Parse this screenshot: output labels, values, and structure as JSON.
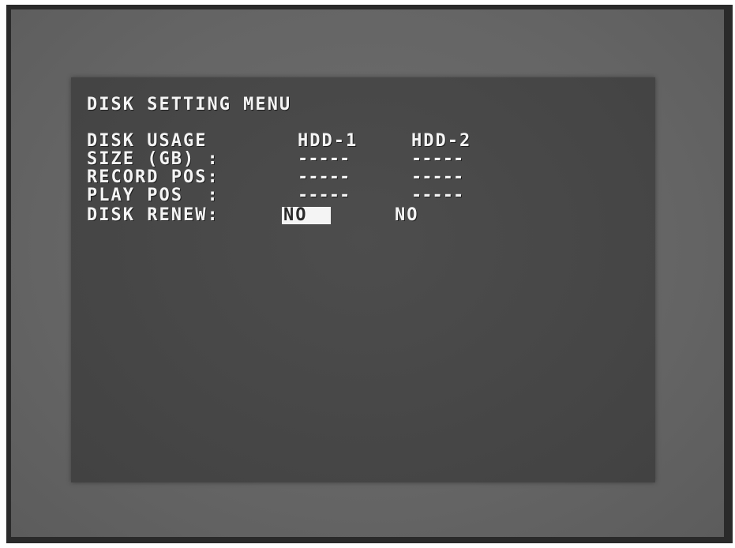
{
  "menu": {
    "title": "DISK SETTING MENU",
    "rows": [
      {
        "label": "DISK USAGE",
        "hdd1": "HDD-1",
        "hdd2": "HDD-2"
      },
      {
        "label": "SIZE (GB) :",
        "hdd1": "-----",
        "hdd2": "-----"
      },
      {
        "label": "RECORD POS:",
        "hdd1": "-----",
        "hdd2": "-----"
      },
      {
        "label": "PLAY POS  :",
        "hdd1": "-----",
        "hdd2": "-----"
      }
    ],
    "renew": {
      "label": "DISK RENEW:",
      "hdd1_value": "NO",
      "hdd2_value": "NO"
    }
  },
  "colors": {
    "text": "#f4f4f4",
    "screen": "#474747",
    "surround": "#656565",
    "selection": "#f4f4f4"
  }
}
